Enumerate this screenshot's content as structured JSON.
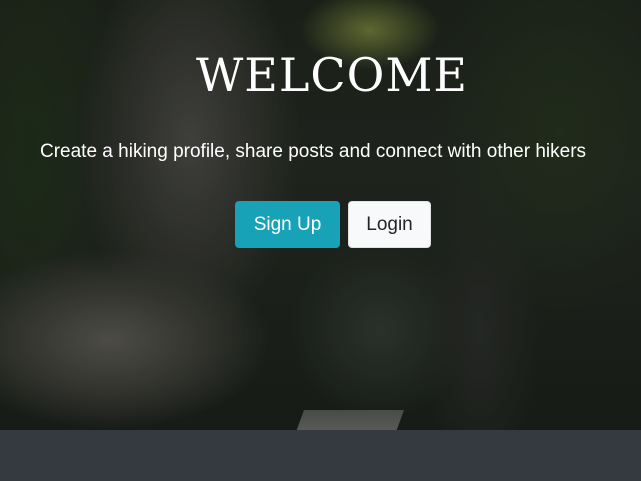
{
  "hero": {
    "title": "WELCOME",
    "subtitle": "Create a hiking profile, share posts and connect with other hikers",
    "signup_label": "Sign Up",
    "login_label": "Login"
  },
  "colors": {
    "signup_button": "#17a2b8",
    "login_button": "#f8f9fa",
    "footer": "#343a40"
  }
}
